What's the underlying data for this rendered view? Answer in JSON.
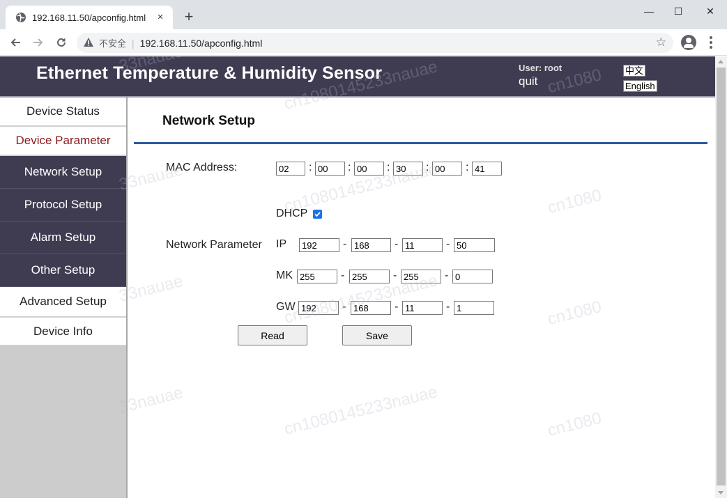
{
  "browser": {
    "tab_title": "192.168.11.50/apconfig.html",
    "tab_close": "×",
    "new_tab": "+",
    "security_label": "不安全",
    "url": "192.168.11.50/apconfig.html",
    "window_controls": {
      "minimize": "—",
      "maximize": "☐",
      "close": "✕"
    }
  },
  "header": {
    "title": "Ethernet Temperature & Humidity Sensor",
    "user_label": "User: root",
    "quit_label": "quit",
    "lang_chinese": "中文",
    "lang_english": "English"
  },
  "sidebar": {
    "items": [
      {
        "label": "Device Status",
        "style": "light"
      },
      {
        "label": "Device Parameter",
        "style": "light-active"
      },
      {
        "label": "Network Setup",
        "style": "dark"
      },
      {
        "label": "Protocol Setup",
        "style": "dark"
      },
      {
        "label": "Alarm Setup",
        "style": "dark"
      },
      {
        "label": "Other Setup",
        "style": "dark"
      },
      {
        "label": "Advanced Setup",
        "style": "light"
      },
      {
        "label": "Device Info",
        "style": "light"
      }
    ]
  },
  "main": {
    "section_title": "Network Setup",
    "mac_label": "MAC Address:",
    "mac_separator": ":",
    "mac": [
      "02",
      "00",
      "00",
      "30",
      "00",
      "41"
    ],
    "dhcp_label": "DHCP",
    "dhcp_checked": true,
    "network_param_label": "Network Parameter",
    "ip_separator": "-",
    "ip_label": "IP",
    "ip": [
      "192",
      "168",
      "11",
      "50"
    ],
    "mask_label": "MK",
    "mask": [
      "255",
      "255",
      "255",
      "0"
    ],
    "gateway_label": "GW",
    "gateway": [
      "192",
      "168",
      "11",
      "1"
    ],
    "read_button": "Read",
    "save_button": "Save"
  },
  "colors": {
    "header_bg": "#3f3c52",
    "active_sidebar_text": "#8b1a1a",
    "section_rule": "#2a5aa0",
    "checkbox_accent": "#1a73e8"
  },
  "watermarks": [
    "cn1080145233nauae",
    "33nauae",
    "cn1080"
  ]
}
